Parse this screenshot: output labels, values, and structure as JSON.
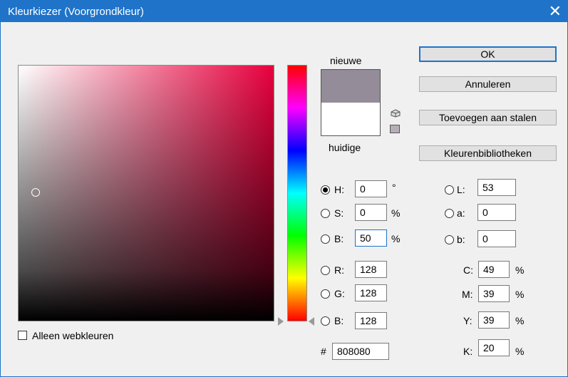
{
  "window": {
    "title": "Kleurkiezer (Voorgrondkleur)",
    "close_icon": "close-icon"
  },
  "swatch": {
    "new_label": "nieuwe",
    "current_label": "huidige",
    "new_color": "#948c98",
    "current_color": "#ffffff"
  },
  "buttons": {
    "ok": "OK",
    "cancel": "Annuleren",
    "add_to_swatches": "Toevoegen aan stalen",
    "color_libraries": "Kleurenbibliotheken"
  },
  "hsb": {
    "h": {
      "label": "H:",
      "value": "0",
      "unit": "°",
      "selected": true
    },
    "s": {
      "label": "S:",
      "value": "0",
      "unit": "%"
    },
    "b": {
      "label": "B:",
      "value": "50",
      "unit": "%"
    }
  },
  "rgb": {
    "r": {
      "label": "R:",
      "value": "128"
    },
    "g": {
      "label": "G:",
      "value": "128"
    },
    "b": {
      "label": "B:",
      "value": "128"
    }
  },
  "lab": {
    "l": {
      "label": "L:",
      "value": "53"
    },
    "a": {
      "label": "a:",
      "value": "0"
    },
    "b": {
      "label": "b:",
      "value": "0"
    }
  },
  "cmyk": {
    "c": {
      "label": "C:",
      "value": "49",
      "unit": "%"
    },
    "m": {
      "label": "M:",
      "value": "39",
      "unit": "%"
    },
    "y": {
      "label": "Y:",
      "value": "39",
      "unit": "%"
    },
    "k": {
      "label": "K:",
      "value": "20",
      "unit": "%"
    }
  },
  "hex": {
    "label": "#",
    "value": "808080"
  },
  "web_only": {
    "label": "Alleen webkleuren",
    "checked": false
  }
}
